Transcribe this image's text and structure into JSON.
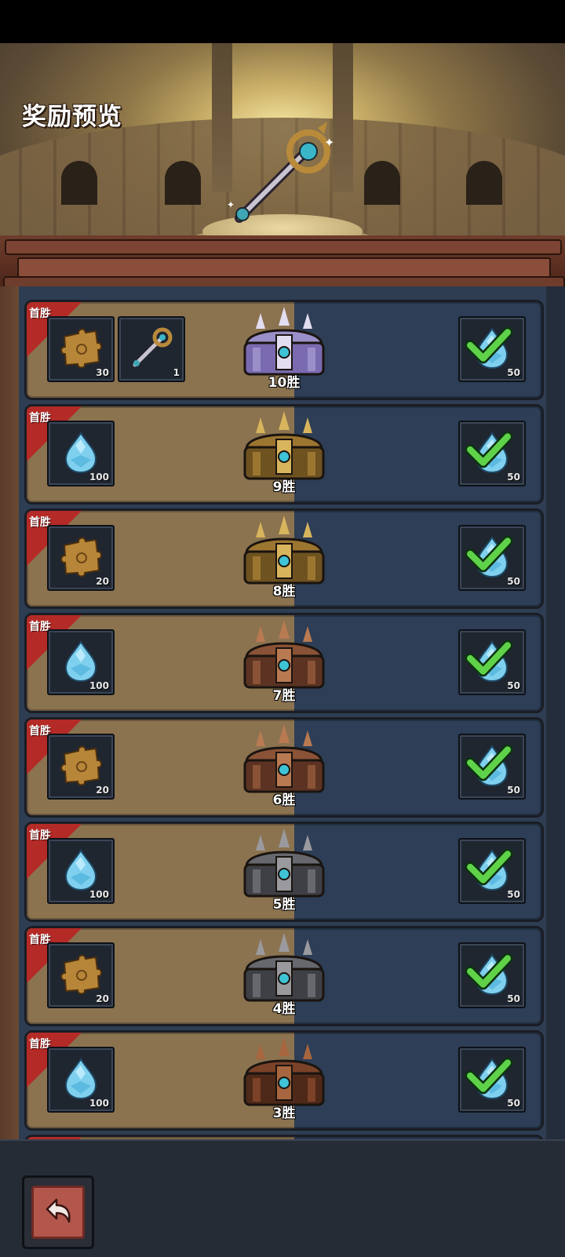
{
  "header": {
    "title": "奖励预览",
    "featured_icon": "key-staff-icon"
  },
  "ribbon_label": "首胜",
  "rows": [
    {
      "wins": "10胜",
      "tier": "crystal",
      "rewards": [
        {
          "icon": "puzzle-piece-icon",
          "count": "30"
        },
        {
          "icon": "key-staff-icon",
          "count": "1"
        }
      ],
      "right": {
        "icon": "crystal-drop-icon",
        "count": "50",
        "claimed": true
      }
    },
    {
      "wins": "9胜",
      "tier": "gold",
      "rewards": [
        {
          "icon": "crystal-drop-icon",
          "count": "100"
        }
      ],
      "right": {
        "icon": "crystal-drop-icon",
        "count": "50",
        "claimed": true
      }
    },
    {
      "wins": "8胜",
      "tier": "gold",
      "rewards": [
        {
          "icon": "puzzle-piece-icon",
          "count": "20"
        }
      ],
      "right": {
        "icon": "crystal-drop-icon",
        "count": "50",
        "claimed": true
      }
    },
    {
      "wins": "7胜",
      "tier": "bronze",
      "rewards": [
        {
          "icon": "crystal-drop-icon",
          "count": "100"
        }
      ],
      "right": {
        "icon": "crystal-drop-icon",
        "count": "50",
        "claimed": true
      }
    },
    {
      "wins": "6胜",
      "tier": "bronze",
      "rewards": [
        {
          "icon": "puzzle-piece-icon",
          "count": "20"
        }
      ],
      "right": {
        "icon": "crystal-drop-icon",
        "count": "50",
        "claimed": true
      }
    },
    {
      "wins": "5胜",
      "tier": "iron",
      "rewards": [
        {
          "icon": "crystal-drop-icon",
          "count": "100"
        }
      ],
      "right": {
        "icon": "crystal-drop-icon",
        "count": "50",
        "claimed": true
      }
    },
    {
      "wins": "4胜",
      "tier": "iron",
      "rewards": [
        {
          "icon": "puzzle-piece-icon",
          "count": "20"
        }
      ],
      "right": {
        "icon": "crystal-drop-icon",
        "count": "50",
        "claimed": true
      }
    },
    {
      "wins": "3胜",
      "tier": "wood",
      "rewards": [
        {
          "icon": "crystal-drop-icon",
          "count": "100"
        }
      ],
      "right": {
        "icon": "crystal-drop-icon",
        "count": "50",
        "claimed": true
      }
    }
  ],
  "footer": {
    "back_icon": "back-arrow-icon"
  },
  "colors": {
    "ribbon": "#b42a26",
    "check": "#5fd24a",
    "row_left": "#8b7350",
    "row_right": "#2d3e56"
  }
}
